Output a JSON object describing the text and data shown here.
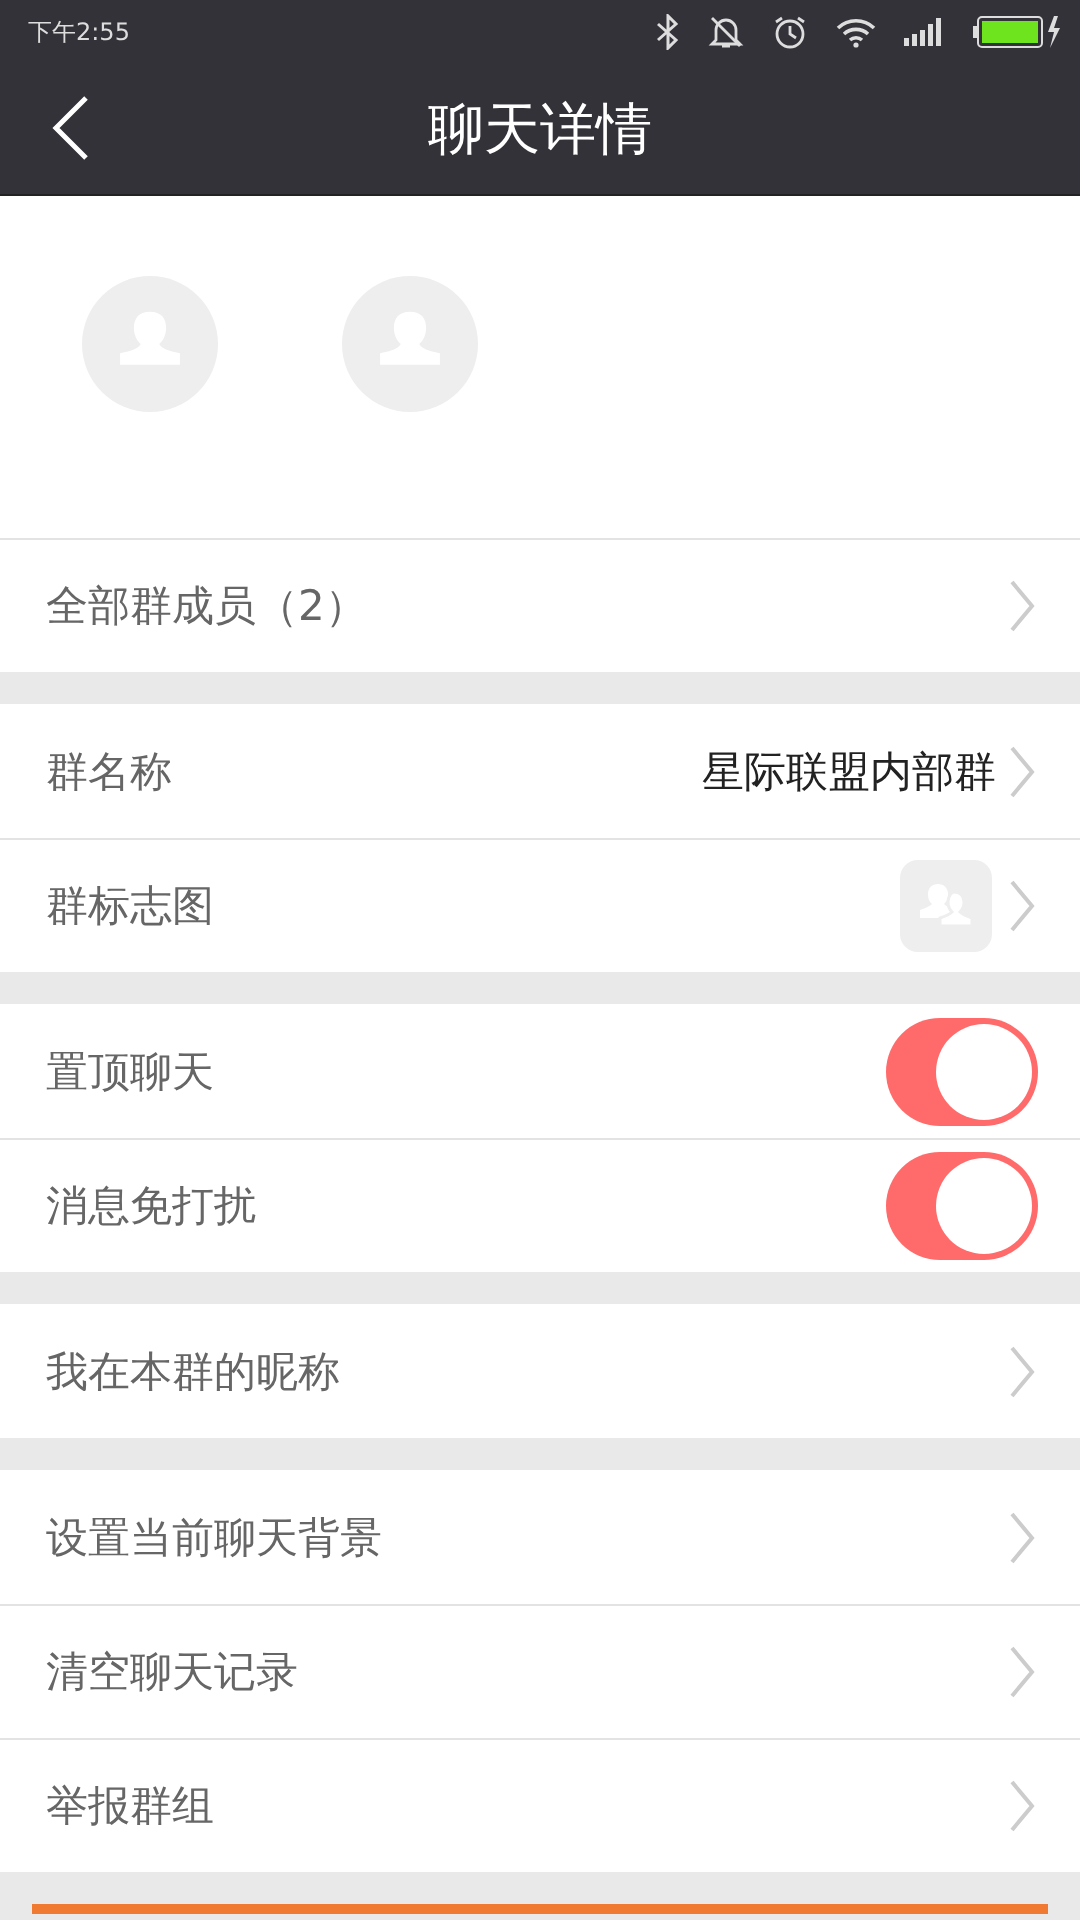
{
  "status_bar": {
    "time": "下午2:55"
  },
  "nav_bar": {
    "title": "聊天详情"
  },
  "members": [
    {
      "kind": "avatar"
    },
    {
      "kind": "avatar"
    }
  ],
  "sections": [
    [
      {
        "kind": "link",
        "label": "全部群成员（2）"
      }
    ],
    [
      {
        "kind": "value",
        "label": "群名称",
        "value": "星际联盟内部群"
      },
      {
        "kind": "image",
        "label": "群标志图"
      }
    ],
    [
      {
        "kind": "toggle",
        "label": "置顶聊天",
        "on": true
      },
      {
        "kind": "toggle",
        "label": "消息免打扰",
        "on": true
      }
    ],
    [
      {
        "kind": "link",
        "label": "我在本群的昵称"
      }
    ],
    [
      {
        "kind": "link",
        "label": "设置当前聊天背景"
      },
      {
        "kind": "link",
        "label": "清空聊天记录"
      },
      {
        "kind": "link",
        "label": "举报群组"
      }
    ]
  ]
}
